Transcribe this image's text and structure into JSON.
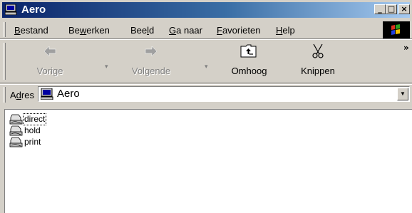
{
  "window": {
    "title": "Aero",
    "minimize_glyph": "_",
    "maximize_glyph": "□",
    "close_glyph": "×"
  },
  "menu": {
    "items": [
      {
        "prefix": "",
        "key": "B",
        "rest": "estand"
      },
      {
        "prefix": "Be",
        "key": "w",
        "rest": "erken"
      },
      {
        "prefix": "Bee",
        "key": "l",
        "rest": "d"
      },
      {
        "prefix": "",
        "key": "G",
        "rest": "a naar"
      },
      {
        "prefix": "",
        "key": "F",
        "rest": "avorieten"
      },
      {
        "prefix": "",
        "key": "H",
        "rest": "elp"
      }
    ]
  },
  "toolbar": {
    "back_label": "Vorige",
    "forward_label": "Volgende",
    "up_label": "Omhoog",
    "cut_label": "Knippen",
    "more_glyph": "»"
  },
  "address": {
    "label_prefix": "A",
    "label_key": "d",
    "label_rest": "res",
    "value": "Aero"
  },
  "files": [
    {
      "name": "direct"
    },
    {
      "name": "hold"
    },
    {
      "name": "print"
    }
  ],
  "colors": {
    "titlebar_start": "#0a246a",
    "titlebar_end": "#a6caf0",
    "face": "#d4d0c8"
  }
}
